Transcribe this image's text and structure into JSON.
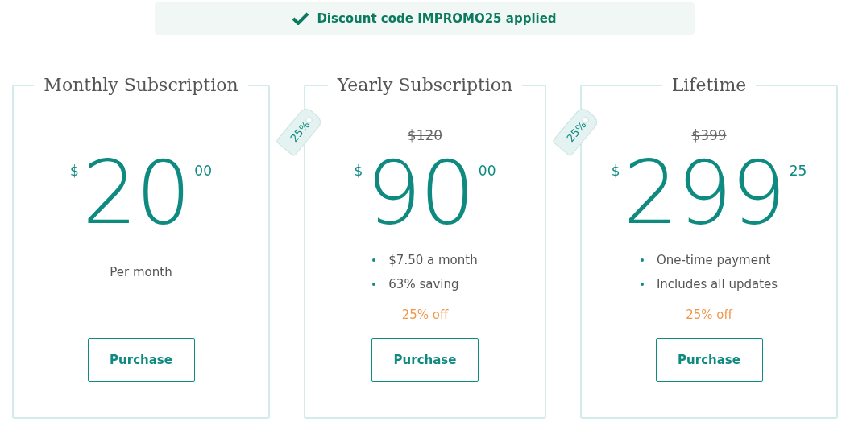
{
  "banner": {
    "text": "Discount code IMPROMO25 applied"
  },
  "plans": [
    {
      "title": "Monthly Subscription",
      "currency": "$",
      "amount": "20",
      "cents": "00",
      "note": "Per month",
      "button": "Purchase"
    },
    {
      "title": "Yearly Subscription",
      "tag": "25%",
      "old_price": "$120",
      "currency": "$",
      "amount": "90",
      "cents": "00",
      "features": [
        "$7.50 a month",
        "63% saving"
      ],
      "discount": "25% off",
      "button": "Purchase"
    },
    {
      "title": "Lifetime",
      "tag": "25%",
      "old_price": "$399",
      "currency": "$",
      "amount": "299",
      "cents": "25",
      "features": [
        "One-time payment",
        "Includes all updates"
      ],
      "discount": "25% off",
      "button": "Purchase"
    }
  ]
}
